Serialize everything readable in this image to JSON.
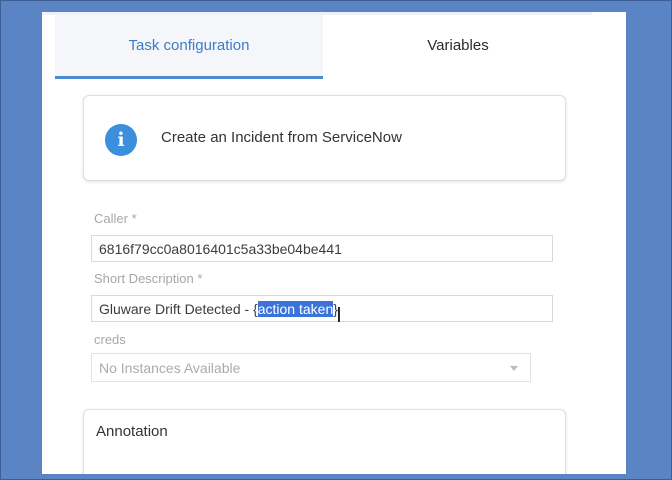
{
  "tabs": {
    "task_configuration": "Task configuration",
    "variables": "Variables"
  },
  "info": {
    "text": "Create an Incident from ServiceNow",
    "icon": "i"
  },
  "fields": {
    "caller": {
      "label": "Caller *",
      "value": "6816f79cc0a8016401c5a33be04be441"
    },
    "short_description": {
      "label": "Short Description *",
      "value_prefix": "Gluware Drift Detected - {",
      "value_selected": "action taken",
      "value_suffix": "}"
    },
    "creds": {
      "label": "creds",
      "selected": "No Instances Available"
    }
  },
  "annotation": {
    "title": "Annotation"
  },
  "colors": {
    "accent": "#3d7cc7",
    "info_icon": "#3b8fdc",
    "selection": "#3a73d9",
    "background": "#5b84c4"
  }
}
